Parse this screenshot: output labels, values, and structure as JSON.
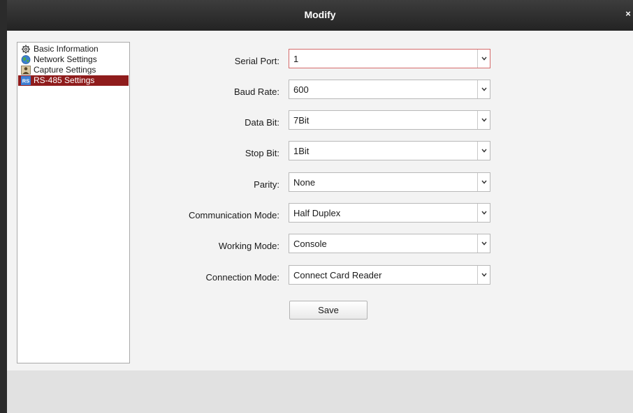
{
  "window": {
    "title": "Modify",
    "close_glyph": "×"
  },
  "sidebar": {
    "items": [
      {
        "label": "Basic Information",
        "icon": "gear-icon"
      },
      {
        "label": "Network Settings",
        "icon": "globe-icon"
      },
      {
        "label": "Capture Settings",
        "icon": "capture-icon"
      },
      {
        "label": "RS-485 Settings",
        "icon": "rs-icon",
        "icon_text": "RS",
        "selected": true
      }
    ]
  },
  "form": {
    "fields": [
      {
        "label": "Serial Port:",
        "value": "1"
      },
      {
        "label": "Baud Rate:",
        "value": "600"
      },
      {
        "label": "Data Bit:",
        "value": "7Bit"
      },
      {
        "label": "Stop Bit:",
        "value": "1Bit"
      },
      {
        "label": "Parity:",
        "value": "None"
      },
      {
        "label": "Communication Mode:",
        "value": "Half Duplex"
      },
      {
        "label": "Working Mode:",
        "value": "Console"
      },
      {
        "label": "Connection Mode:",
        "value": "Connect Card Reader"
      }
    ],
    "save_label": "Save"
  },
  "colors": {
    "selected_bg": "#8f1c1c",
    "focus_border": "#d46a6a"
  }
}
